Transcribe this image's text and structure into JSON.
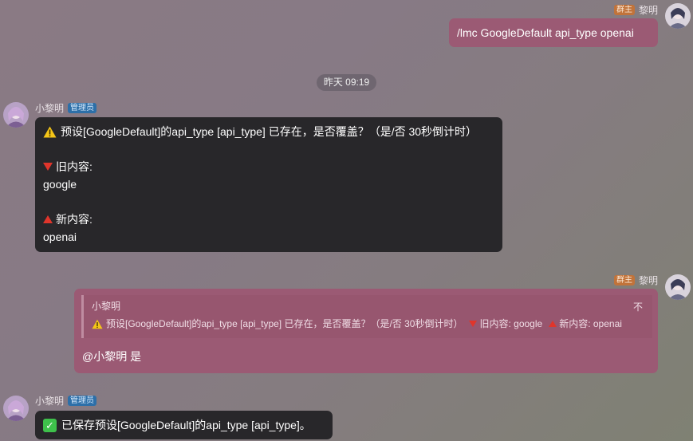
{
  "colors": {
    "my_bubble": "#9b5a74",
    "bot_bubble": "#28272a",
    "owner_badge": "#c1733a",
    "admin_badge": "#2d6fa8"
  },
  "messages": [
    {
      "sender": "黎明",
      "badge": "群主",
      "text": "/lmc GoogleDefault api_type openai"
    },
    {
      "timestamp": "昨天 09:19"
    },
    {
      "sender": "小黎明",
      "badge": "管理员",
      "warning": "预设[GoogleDefault]的api_type [api_type] 已存在，是否覆盖？（是/否 30秒倒计时）",
      "old_label": "旧内容:",
      "old_value": "google",
      "new_label": "新内容:",
      "new_value": "openai"
    },
    {
      "sender": "黎明",
      "badge": "群主",
      "quote": {
        "name": "小黎明",
        "text": "预设[GoogleDefault]的api_type [api_type] 已存在，是否覆盖？（是/否 30秒倒计时）",
        "old": "旧内容: google",
        "new": "新内容: openai",
        "close": "不"
      },
      "text": "@小黎明 是"
    },
    {
      "sender": "小黎明",
      "badge": "管理员",
      "text": "已保存预设[GoogleDefault]的api_type [api_type]。"
    }
  ]
}
